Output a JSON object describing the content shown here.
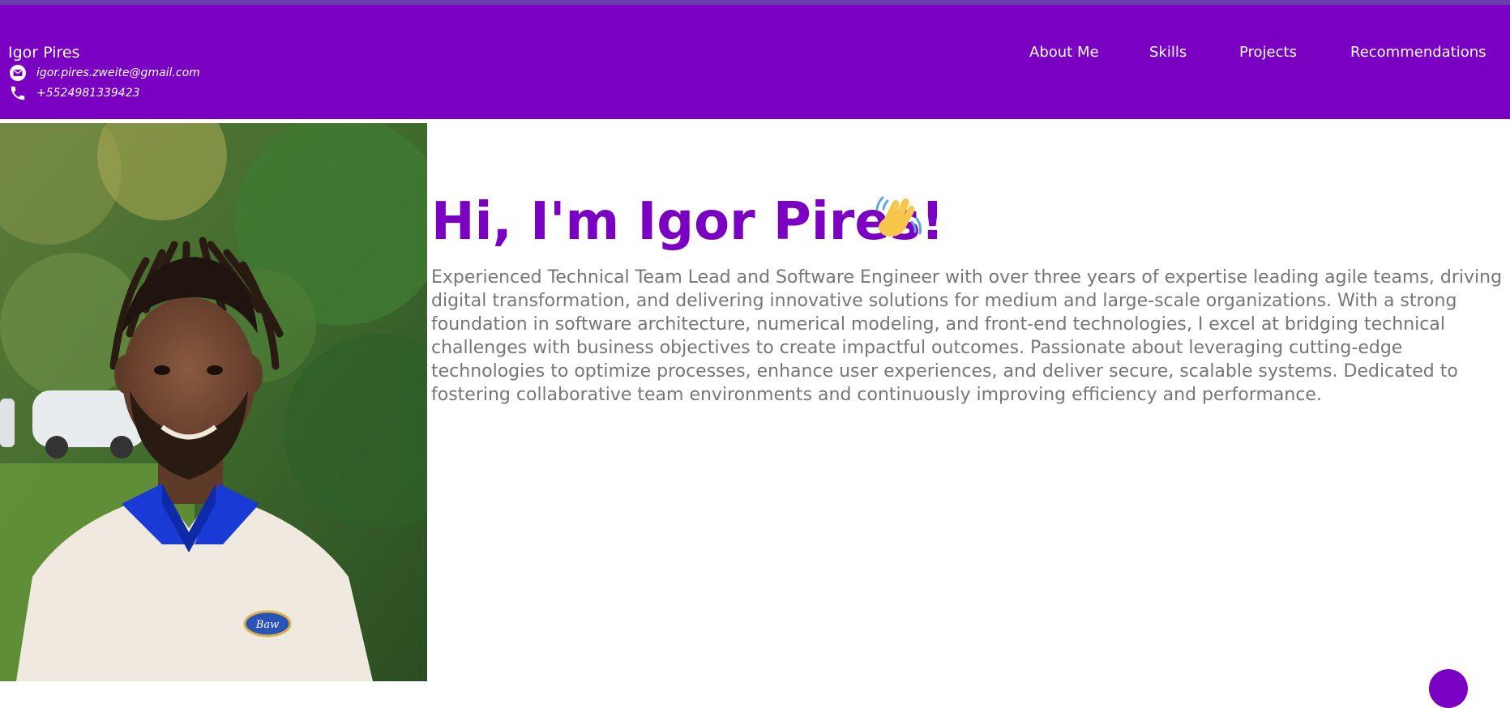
{
  "header": {
    "name": "Igor Pires",
    "email": "igor.pires.zweite@gmail.com",
    "phone": "+5524981339423",
    "email_icon": "envelope-icon",
    "phone_icon": "phone-icon",
    "nav": [
      {
        "label": "About Me"
      },
      {
        "label": "Skills"
      },
      {
        "label": "Projects"
      },
      {
        "label": "Recommendations"
      }
    ]
  },
  "hero": {
    "title": "Hi, I'm Igor Pires!",
    "wave_icon": "waving-hand-icon",
    "bio": "Experienced Technical Team Lead and Software Engineer with over three years of expertise leading agile teams, driving digital transformation, and delivering innovative solutions for medium and large-scale organizations. With a strong foundation in software architecture, numerical modeling, and front-end technologies, I excel at bridging technical challenges with business objectives to create impactful outcomes. Passionate about leveraging cutting-edge technologies to optimize processes, enhance user experiences, and deliver secure, scalable systems. Dedicated to fostering collaborative team environments and continuously improving efficiency and performance."
  },
  "photo": {
    "badge_text": "Baw"
  },
  "colors": {
    "primary": "#7a00c2",
    "text_muted": "#767676",
    "white": "#ffffff"
  }
}
